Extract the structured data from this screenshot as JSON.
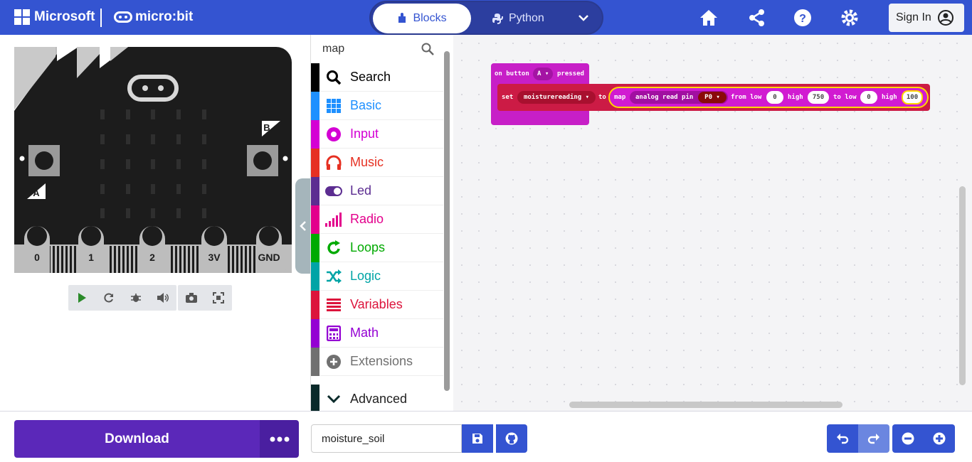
{
  "header": {
    "brand": "Microsoft",
    "product": "micro:bit",
    "modes": {
      "blocks": "Blocks",
      "python": "Python"
    },
    "sign_in": "Sign In"
  },
  "simulator": {
    "buttons": {
      "a": "A",
      "b": "B"
    },
    "pins": [
      "0",
      "1",
      "2",
      "3V",
      "GND"
    ]
  },
  "toolbox": {
    "search_value": "map",
    "categories": [
      {
        "label": "Search",
        "color": "#000000"
      },
      {
        "label": "Basic",
        "color": "#1e90ff"
      },
      {
        "label": "Input",
        "color": "#d400d4"
      },
      {
        "label": "Music",
        "color": "#e63022"
      },
      {
        "label": "Led",
        "color": "#5c2d91"
      },
      {
        "label": "Radio",
        "color": "#e3008c"
      },
      {
        "label": "Loops",
        "color": "#00aa00"
      },
      {
        "label": "Logic",
        "color": "#00a4a6"
      },
      {
        "label": "Variables",
        "color": "#dc143c"
      },
      {
        "label": "Math",
        "color": "#9400d3"
      },
      {
        "label": "Extensions",
        "color": "#707070"
      }
    ],
    "advanced": "Advanced"
  },
  "workspace": {
    "event": {
      "prefix": "on button",
      "button": "A",
      "suffix": "pressed"
    },
    "set": {
      "keyword": "set",
      "variable": "moisturereading",
      "to": "to"
    },
    "map": {
      "keyword": "map",
      "reporter": "analog read pin",
      "pin": "P0",
      "from_low_label": "from low",
      "from_low": "0",
      "high_label": "high",
      "from_high": "750",
      "to_low_label": "to low",
      "to_low": "0",
      "to_high_label": "high",
      "to_high": "100"
    }
  },
  "bottom": {
    "download": "Download",
    "project_name": "moisture_soil"
  }
}
